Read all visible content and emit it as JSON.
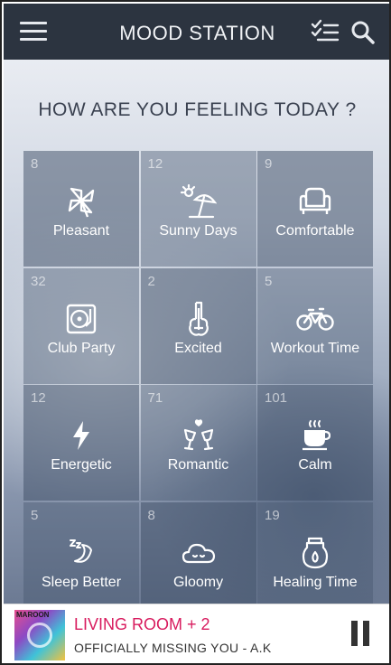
{
  "header": {
    "title": "MOOD STATION",
    "icons": [
      "menu-icon",
      "filter-list-icon",
      "search-icon"
    ]
  },
  "prompt": "HOW ARE YOU FEELING TODAY ?",
  "moods": [
    {
      "label": "Pleasant",
      "count": "8",
      "icon": "pinwheel-icon"
    },
    {
      "label": "Sunny Days",
      "count": "12",
      "icon": "beach-umbrella-icon"
    },
    {
      "label": "Comfortable",
      "count": "9",
      "icon": "armchair-icon"
    },
    {
      "label": "Club Party",
      "count": "32",
      "icon": "turntable-icon"
    },
    {
      "label": "Excited",
      "count": "2",
      "icon": "guitar-icon"
    },
    {
      "label": "Workout Time",
      "count": "5",
      "icon": "bicycle-icon"
    },
    {
      "label": "Energetic",
      "count": "12",
      "icon": "lightning-icon"
    },
    {
      "label": "Romantic",
      "count": "71",
      "icon": "champagne-glasses-icon"
    },
    {
      "label": "Calm",
      "count": "101",
      "icon": "coffee-cup-icon"
    },
    {
      "label": "Sleep Better",
      "count": "5",
      "icon": "moon-zzz-icon"
    },
    {
      "label": "Gloomy",
      "count": "8",
      "icon": "cloud-icon"
    },
    {
      "label": "Healing Time",
      "count": "19",
      "icon": "aroma-burner-icon"
    }
  ],
  "player": {
    "title": "LIVING ROOM + 2",
    "subtitle": "OFFICIALLY MISSING YOU - A.K",
    "album_text": "MAROON",
    "state_icon": "pause-icon",
    "title_color": "#d81b5e"
  }
}
